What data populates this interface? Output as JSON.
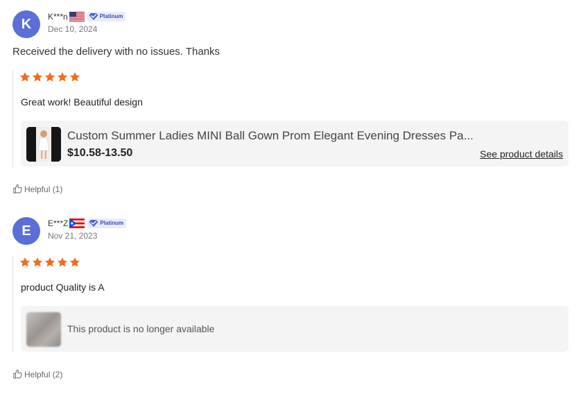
{
  "reviews": [
    {
      "avatar_letter": "K",
      "name": "K***n",
      "flag": "us-flag-icon",
      "badge": "Platinum",
      "date": "Dec 10, 2024",
      "text": "Received the delivery with no issues. Thanks",
      "rating": 5,
      "inner_text": "Great work! Beautiful design",
      "product": {
        "title": "Custom Summer Ladies MINI Ball Gown Prom Elegant Evening Dresses Pa...",
        "price": "$10.58-13.50",
        "details_link": "See product details"
      },
      "helpful": "Helpful (1)"
    },
    {
      "avatar_letter": "E",
      "name": "E***Z",
      "flag": "puerto-rico-flag-icon",
      "badge": "Platinum",
      "date": "Nov 21, 2023",
      "rating": 5,
      "inner_text": "product Quality is A",
      "product": {
        "unavailable": "This product is no longer available"
      },
      "helpful": "Helpful (2)"
    }
  ],
  "colors": {
    "star": "#f26b1d",
    "avatar": "#5b6fd6",
    "badge_bg": "#e8ecfb",
    "badge_text": "#3b4bb0"
  }
}
